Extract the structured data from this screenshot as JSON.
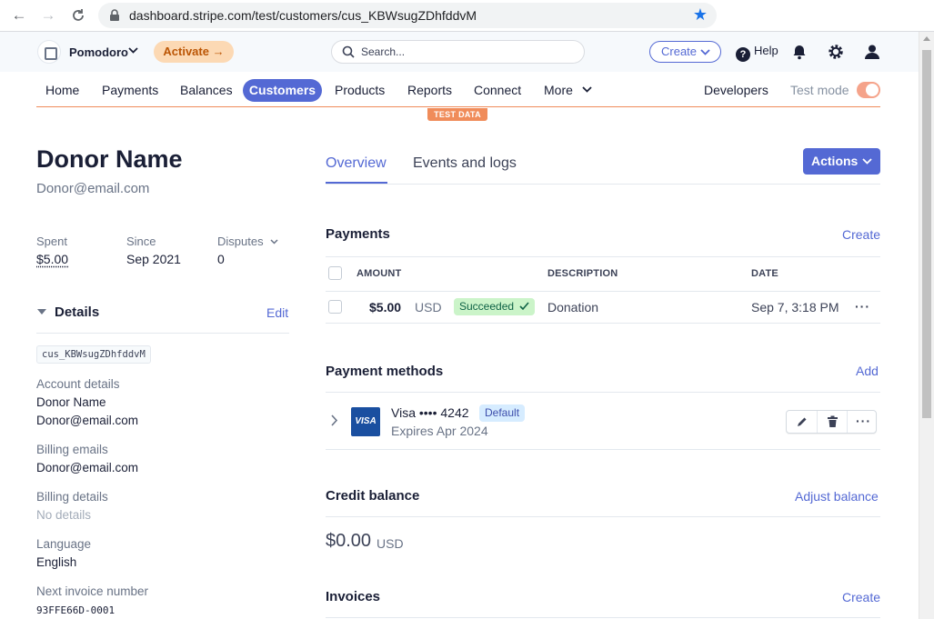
{
  "browser": {
    "url": "dashboard.stripe.com/test/customers/cus_KBWsugZDhfddvM"
  },
  "header": {
    "account_name": "Pomodoro",
    "activate_label": "Activate",
    "search_placeholder": "Search...",
    "create_label": "Create",
    "help_label": "Help"
  },
  "nav": {
    "items": [
      "Home",
      "Payments",
      "Balances",
      "Customers",
      "Products",
      "Reports",
      "Connect",
      "More"
    ],
    "active": "Customers",
    "developers": "Developers",
    "test_mode": "Test mode",
    "test_data_badge": "TEST DATA"
  },
  "customer": {
    "name": "Donor Name",
    "email": "Donor@email.com",
    "stats": {
      "spent_label": "Spent",
      "spent_value": "$5.00",
      "since_label": "Since",
      "since_value": "Sep 2021",
      "disputes_label": "Disputes",
      "disputes_value": "0"
    },
    "details": {
      "title": "Details",
      "edit": "Edit",
      "id": "cus_KBWsugZDhfddvM",
      "account_details_label": "Account details",
      "account_name": "Donor Name",
      "account_email": "Donor@email.com",
      "billing_emails_label": "Billing emails",
      "billing_email": "Donor@email.com",
      "billing_details_label": "Billing details",
      "billing_details_value": "No details",
      "language_label": "Language",
      "language_value": "English",
      "next_invoice_label": "Next invoice number",
      "next_invoice_value": "93FFE66D-0001"
    }
  },
  "tabs": [
    "Overview",
    "Events and logs"
  ],
  "actions_label": "Actions",
  "payments": {
    "title": "Payments",
    "create": "Create",
    "columns": [
      "AMOUNT",
      "DESCRIPTION",
      "DATE"
    ],
    "rows": [
      {
        "amount": "$5.00",
        "currency": "USD",
        "status": "Succeeded",
        "description": "Donation",
        "date": "Sep 7, 3:18 PM"
      }
    ]
  },
  "payment_methods": {
    "title": "Payment methods",
    "add": "Add",
    "card_brand": "VISA",
    "card_name": "Visa •••• 4242",
    "default_badge": "Default",
    "expires": "Expires Apr 2024"
  },
  "credit_balance": {
    "title": "Credit balance",
    "adjust": "Adjust balance",
    "amount": "$0.00",
    "currency": "USD"
  },
  "invoices": {
    "title": "Invoices",
    "create": "Create"
  }
}
